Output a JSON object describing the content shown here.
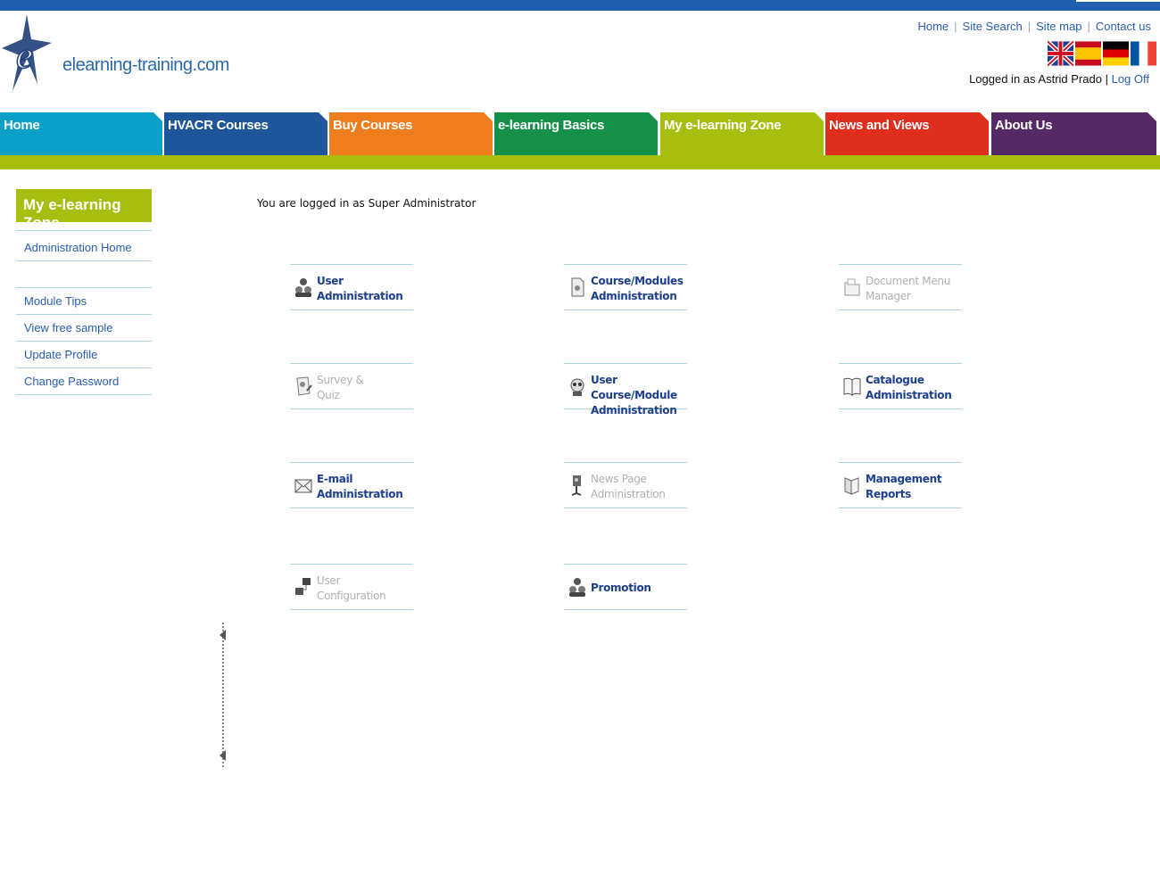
{
  "site": {
    "name": "elearning-training.com"
  },
  "toplinks": [
    "Home",
    "Site Search",
    "Site map",
    "Contact us"
  ],
  "flags": [
    "flag-uk-icon",
    "flag-es-icon",
    "flag-de-icon",
    "flag-fr-icon"
  ],
  "login": {
    "text": "Logged in as Astrid Prado",
    "separator": "|",
    "logoff": "Log Off"
  },
  "nav": {
    "tabs": [
      {
        "label": "Home",
        "color": "#0aa0c8"
      },
      {
        "label": "HVACR Courses",
        "color": "#1f5699"
      },
      {
        "label": "Buy Courses",
        "color": "#ef7d1e"
      },
      {
        "label": "e-learning Basics",
        "color": "#14904a"
      },
      {
        "label": "My e-learning Zone",
        "color": "#a7be11"
      },
      {
        "label": "News and Views",
        "color": "#df2e1d"
      },
      {
        "label": "About Us",
        "color": "#542a66"
      }
    ]
  },
  "sidebar": {
    "heading": "My e-learning Zone",
    "items": [
      "Administration Home",
      "Module Tips",
      "View free sample",
      "Update Profile",
      "Change Password"
    ]
  },
  "main": {
    "welcome": "You are logged in as Super Administrator",
    "tiles": [
      {
        "line1": "User",
        "line2": "Administration",
        "icon": "users-icon",
        "enabled": true
      },
      {
        "line1": "Course/Modules",
        "line2": "Administration",
        "icon": "document-icon",
        "enabled": true
      },
      {
        "line1": "Document Menu",
        "line2": "Manager",
        "icon": "folder-icon",
        "enabled": false
      },
      {
        "line1": "Survey &",
        "line2": "Quiz",
        "icon": "survey-icon",
        "enabled": false
      },
      {
        "line1": "User Course/Module",
        "line2": "Administration",
        "icon": "user-course-icon",
        "enabled": true
      },
      {
        "line1": "Catalogue",
        "line2": "Administration",
        "icon": "book-icon",
        "enabled": true
      },
      {
        "line1": "E-mail",
        "line2": "Administration",
        "icon": "envelope-icon",
        "enabled": true
      },
      {
        "line1": "News Page",
        "line2": "Administration",
        "icon": "news-icon",
        "enabled": false
      },
      {
        "line1": "Management",
        "line2": "Reports",
        "icon": "reports-icon",
        "enabled": true
      },
      {
        "line1": "User",
        "line2": "Configuration",
        "icon": "network-icon",
        "enabled": false
      },
      {
        "line1": "Promotion",
        "line2": "",
        "icon": "promotion-icon",
        "enabled": true
      }
    ]
  }
}
